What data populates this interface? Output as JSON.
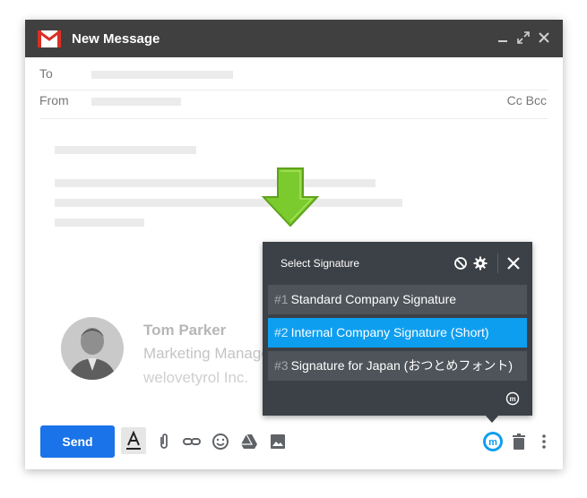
{
  "window": {
    "title": "New Message",
    "logo_icon": "gmail-logo-icon"
  },
  "header_controls": [
    "minimize-icon",
    "expand-icon",
    "close-icon"
  ],
  "fields": {
    "to_label": "To",
    "from_label": "From",
    "cc_bcc_label": "Cc Bcc"
  },
  "signature_preview": {
    "name": "Tom Parker",
    "title": "Marketing Manager",
    "company": "welovetyrol Inc."
  },
  "toolbar": {
    "send_label": "Send",
    "icons": [
      "formatting-icon",
      "attach-icon",
      "link-icon",
      "emoji-icon",
      "drive-icon",
      "photo-icon",
      "mailtastic-icon",
      "trash-icon",
      "more-options-icon"
    ]
  },
  "popup": {
    "title": "Select Signature",
    "selected_index": 1,
    "items": [
      {
        "num": "#1",
        "label": "Standard Company Signature"
      },
      {
        "num": "#2",
        "label": "Internal Company Signature (Short)"
      },
      {
        "num": "#3",
        "label": "Signature for Japan (おつとめフォント)"
      }
    ]
  },
  "colors": {
    "titlebar": "#404040",
    "send": "#1a73e8",
    "popup_bg": "#3c4147",
    "selected": "#0e9ef0",
    "arrow": "#7ccb2e"
  }
}
